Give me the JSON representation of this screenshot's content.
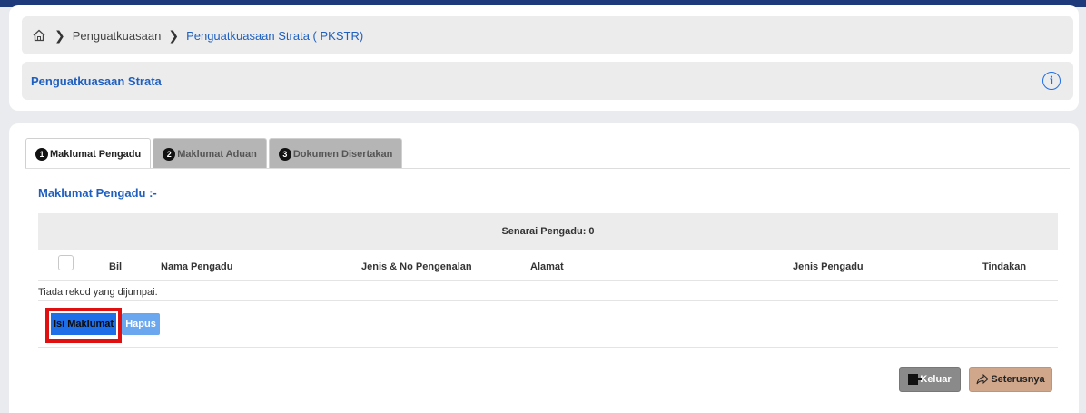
{
  "breadcrumb": {
    "home_icon": "home-icon",
    "items": [
      "Penguatkuasaan",
      "Penguatkuasaan Strata ( PKSTR)"
    ]
  },
  "page": {
    "title": "Penguatkuasaan Strata",
    "info_icon": "info-icon"
  },
  "tabs": [
    {
      "num": "1",
      "label": "Maklumat Pengadu"
    },
    {
      "num": "2",
      "label": "Maklumat Aduan"
    },
    {
      "num": "3",
      "label": "Dokumen Disertakan"
    }
  ],
  "section": {
    "title": "Maklumat Pengadu :-"
  },
  "table": {
    "header": "Senarai Pengadu: 0",
    "columns": [
      "Bil",
      "Nama Pengadu",
      "Jenis & No Pengenalan",
      "Alamat",
      "Jenis Pengadu",
      "Tindakan"
    ],
    "empty_text": "Tiada rekod yang dijumpai."
  },
  "buttons": {
    "isi": "Isi Maklumat",
    "hapus": "Hapus",
    "keluar": "Keluar",
    "seterusnya": "Seterusnya"
  },
  "colors": {
    "accent": "#1f5fbf",
    "primary_button": "#1e6ee8",
    "highlight": "#e01010",
    "next_button": "#d1a78b"
  }
}
